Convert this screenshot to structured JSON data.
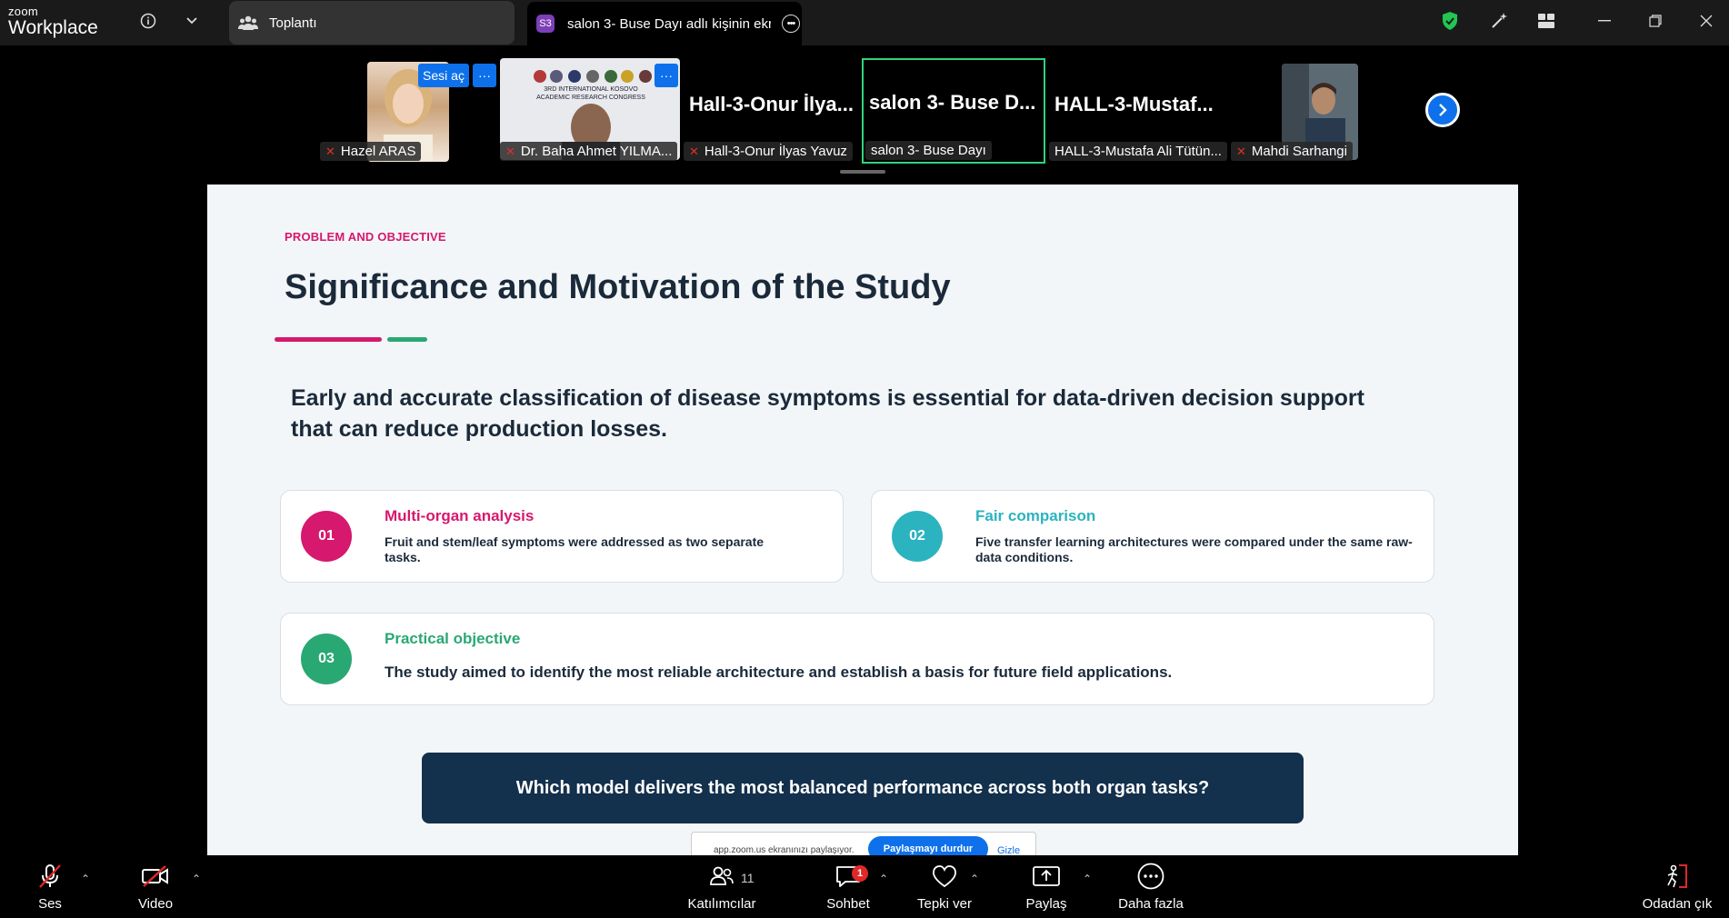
{
  "app": {
    "brand_top": "zoom",
    "brand_bottom": "Workplace"
  },
  "tabs": {
    "meeting": "Toplantı",
    "share_badge": "S3",
    "share": "salon 3- Buse Dayı adlı kişinin ekr"
  },
  "gallery": {
    "unmute_label": "Sesi aç",
    "more_label": "···",
    "participants": [
      {
        "name": "Hazel ARAS",
        "muted": true
      },
      {
        "name": "Dr. Baha Ahmet YILMA...",
        "muted": true
      },
      {
        "name": "Hall-3-Onur İlyas Yavuz",
        "big": "Hall-3-Onur İlya...",
        "muted": true
      },
      {
        "name": "salon 3- Buse Dayı",
        "big": "salon 3- Buse D...",
        "muted": false
      },
      {
        "name": "HALL-3-Mustafa Ali Tütün...",
        "big": "HALL-3-Mustaf...",
        "muted": false
      },
      {
        "name": "Mahdi Sarhangi",
        "muted": true
      }
    ],
    "poster_line1": "3RD INTERNATIONAL KOSOVO",
    "poster_line2": "ACADEMIC RESEARCH CONGRESS"
  },
  "slide": {
    "eyebrow": "PROBLEM AND OBJECTIVE",
    "title": "Significance and Motivation of the Study",
    "lead": "Early and accurate classification of disease symptoms is essential for data-driven decision support that can reduce production losses.",
    "cards": [
      {
        "num": "01",
        "title": "Multi-organ analysis",
        "text": "Fruit and stem/leaf symptoms were addressed as two separate tasks.",
        "color": "#d6186e"
      },
      {
        "num": "02",
        "title": "Fair comparison",
        "text": "Five transfer learning architectures were compared under the same raw-data conditions.",
        "color": "#2bb3c0"
      },
      {
        "num": "03",
        "title": "Practical objective",
        "text": "The study aimed to identify the most reliable architecture and establish a basis for future field applications.",
        "color": "#2aa873"
      }
    ],
    "question": "Which model delivers the most balanced performance across both organ tasks?"
  },
  "share_notice": {
    "text": "app.zoom.us ekranınızı paylaşıyor.",
    "stop": "Paylaşmayı durdur",
    "hide": "Gizle"
  },
  "toolbar": {
    "audio": "Ses",
    "video": "Video",
    "participants": "Katılımcılar",
    "participants_count": "11",
    "chat": "Sohbet",
    "chat_badge": "1",
    "reactions": "Tepki ver",
    "share": "Paylaş",
    "more": "Daha fazla",
    "leave": "Odadan çık"
  },
  "colors": {
    "accent_blue": "#0e71eb",
    "pink": "#d6186e",
    "teal": "#2bb3c0",
    "green": "#2aa873",
    "navy": "#13304c",
    "speaker_border": "#2ed47a",
    "security_green": "#23c552"
  }
}
